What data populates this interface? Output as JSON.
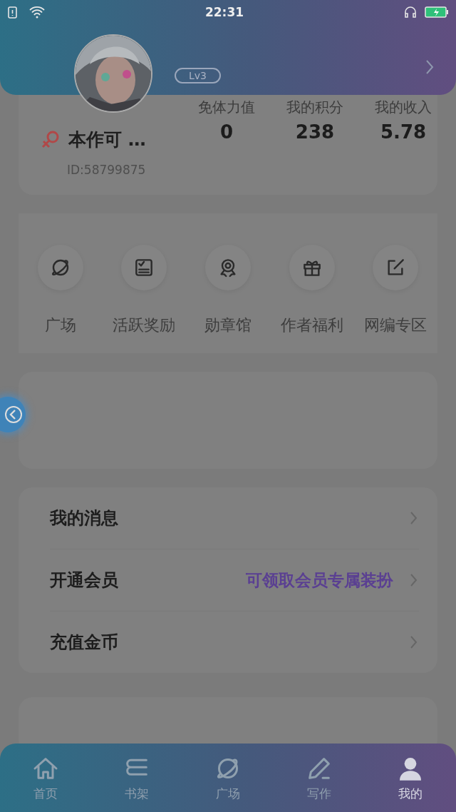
{
  "status_bar": {
    "time": "22:31"
  },
  "profile": {
    "level": "Lv3",
    "name": "本作可 …",
    "id": "ID:58799875",
    "stats": [
      {
        "label": "免体力值",
        "value": "0"
      },
      {
        "label": "我的积分",
        "value": "238"
      },
      {
        "label": "我的收入",
        "value": "5.78"
      }
    ]
  },
  "shortcuts": [
    {
      "label": "广场",
      "kind": "planet"
    },
    {
      "label": "活跃奖励",
      "kind": "board"
    },
    {
      "label": "勋章馆",
      "kind": "medal"
    },
    {
      "label": "作者福利",
      "kind": "gift"
    },
    {
      "label": "网编专区",
      "kind": "edit"
    }
  ],
  "menu": [
    {
      "label": "我的消息"
    },
    {
      "label": "开通会员",
      "hint": "可领取会员专属装扮"
    },
    {
      "label": "充值金币"
    }
  ],
  "tab_bar": [
    {
      "label": "首页",
      "kind": "home",
      "selected": false
    },
    {
      "label": "书架",
      "kind": "shelf",
      "selected": false
    },
    {
      "label": "广场",
      "kind": "planet",
      "selected": false
    },
    {
      "label": "写作",
      "kind": "pen",
      "selected": false
    },
    {
      "label": "我的",
      "kind": "person",
      "selected": true
    }
  ]
}
